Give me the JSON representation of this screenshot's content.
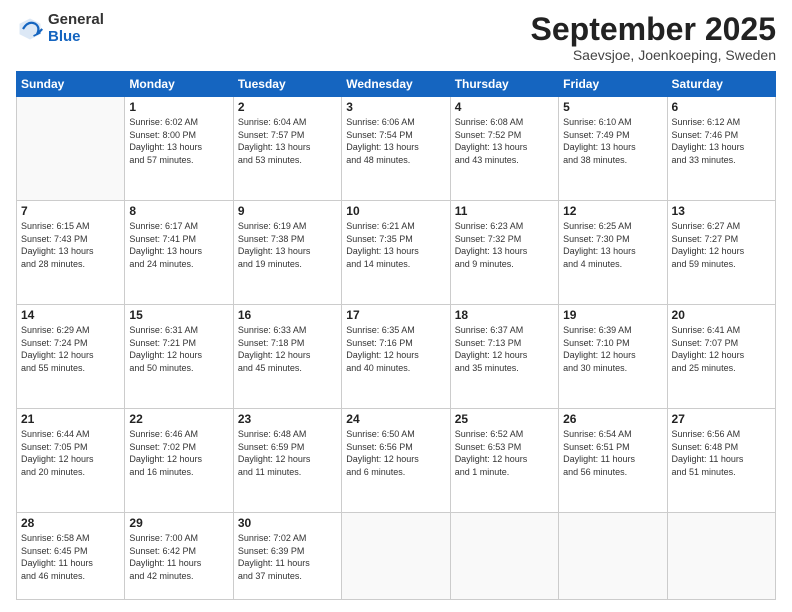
{
  "logo": {
    "general": "General",
    "blue": "Blue"
  },
  "header": {
    "month": "September 2025",
    "location": "Saevsjoe, Joenkoeping, Sweden"
  },
  "weekdays": [
    "Sunday",
    "Monday",
    "Tuesday",
    "Wednesday",
    "Thursday",
    "Friday",
    "Saturday"
  ],
  "weeks": [
    [
      {
        "day": "",
        "info": ""
      },
      {
        "day": "1",
        "info": "Sunrise: 6:02 AM\nSunset: 8:00 PM\nDaylight: 13 hours\nand 57 minutes."
      },
      {
        "day": "2",
        "info": "Sunrise: 6:04 AM\nSunset: 7:57 PM\nDaylight: 13 hours\nand 53 minutes."
      },
      {
        "day": "3",
        "info": "Sunrise: 6:06 AM\nSunset: 7:54 PM\nDaylight: 13 hours\nand 48 minutes."
      },
      {
        "day": "4",
        "info": "Sunrise: 6:08 AM\nSunset: 7:52 PM\nDaylight: 13 hours\nand 43 minutes."
      },
      {
        "day": "5",
        "info": "Sunrise: 6:10 AM\nSunset: 7:49 PM\nDaylight: 13 hours\nand 38 minutes."
      },
      {
        "day": "6",
        "info": "Sunrise: 6:12 AM\nSunset: 7:46 PM\nDaylight: 13 hours\nand 33 minutes."
      }
    ],
    [
      {
        "day": "7",
        "info": "Sunrise: 6:15 AM\nSunset: 7:43 PM\nDaylight: 13 hours\nand 28 minutes."
      },
      {
        "day": "8",
        "info": "Sunrise: 6:17 AM\nSunset: 7:41 PM\nDaylight: 13 hours\nand 24 minutes."
      },
      {
        "day": "9",
        "info": "Sunrise: 6:19 AM\nSunset: 7:38 PM\nDaylight: 13 hours\nand 19 minutes."
      },
      {
        "day": "10",
        "info": "Sunrise: 6:21 AM\nSunset: 7:35 PM\nDaylight: 13 hours\nand 14 minutes."
      },
      {
        "day": "11",
        "info": "Sunrise: 6:23 AM\nSunset: 7:32 PM\nDaylight: 13 hours\nand 9 minutes."
      },
      {
        "day": "12",
        "info": "Sunrise: 6:25 AM\nSunset: 7:30 PM\nDaylight: 13 hours\nand 4 minutes."
      },
      {
        "day": "13",
        "info": "Sunrise: 6:27 AM\nSunset: 7:27 PM\nDaylight: 12 hours\nand 59 minutes."
      }
    ],
    [
      {
        "day": "14",
        "info": "Sunrise: 6:29 AM\nSunset: 7:24 PM\nDaylight: 12 hours\nand 55 minutes."
      },
      {
        "day": "15",
        "info": "Sunrise: 6:31 AM\nSunset: 7:21 PM\nDaylight: 12 hours\nand 50 minutes."
      },
      {
        "day": "16",
        "info": "Sunrise: 6:33 AM\nSunset: 7:18 PM\nDaylight: 12 hours\nand 45 minutes."
      },
      {
        "day": "17",
        "info": "Sunrise: 6:35 AM\nSunset: 7:16 PM\nDaylight: 12 hours\nand 40 minutes."
      },
      {
        "day": "18",
        "info": "Sunrise: 6:37 AM\nSunset: 7:13 PM\nDaylight: 12 hours\nand 35 minutes."
      },
      {
        "day": "19",
        "info": "Sunrise: 6:39 AM\nSunset: 7:10 PM\nDaylight: 12 hours\nand 30 minutes."
      },
      {
        "day": "20",
        "info": "Sunrise: 6:41 AM\nSunset: 7:07 PM\nDaylight: 12 hours\nand 25 minutes."
      }
    ],
    [
      {
        "day": "21",
        "info": "Sunrise: 6:44 AM\nSunset: 7:05 PM\nDaylight: 12 hours\nand 20 minutes."
      },
      {
        "day": "22",
        "info": "Sunrise: 6:46 AM\nSunset: 7:02 PM\nDaylight: 12 hours\nand 16 minutes."
      },
      {
        "day": "23",
        "info": "Sunrise: 6:48 AM\nSunset: 6:59 PM\nDaylight: 12 hours\nand 11 minutes."
      },
      {
        "day": "24",
        "info": "Sunrise: 6:50 AM\nSunset: 6:56 PM\nDaylight: 12 hours\nand 6 minutes."
      },
      {
        "day": "25",
        "info": "Sunrise: 6:52 AM\nSunset: 6:53 PM\nDaylight: 12 hours\nand 1 minute."
      },
      {
        "day": "26",
        "info": "Sunrise: 6:54 AM\nSunset: 6:51 PM\nDaylight: 11 hours\nand 56 minutes."
      },
      {
        "day": "27",
        "info": "Sunrise: 6:56 AM\nSunset: 6:48 PM\nDaylight: 11 hours\nand 51 minutes."
      }
    ],
    [
      {
        "day": "28",
        "info": "Sunrise: 6:58 AM\nSunset: 6:45 PM\nDaylight: 11 hours\nand 46 minutes."
      },
      {
        "day": "29",
        "info": "Sunrise: 7:00 AM\nSunset: 6:42 PM\nDaylight: 11 hours\nand 42 minutes."
      },
      {
        "day": "30",
        "info": "Sunrise: 7:02 AM\nSunset: 6:39 PM\nDaylight: 11 hours\nand 37 minutes."
      },
      {
        "day": "",
        "info": ""
      },
      {
        "day": "",
        "info": ""
      },
      {
        "day": "",
        "info": ""
      },
      {
        "day": "",
        "info": ""
      }
    ]
  ]
}
